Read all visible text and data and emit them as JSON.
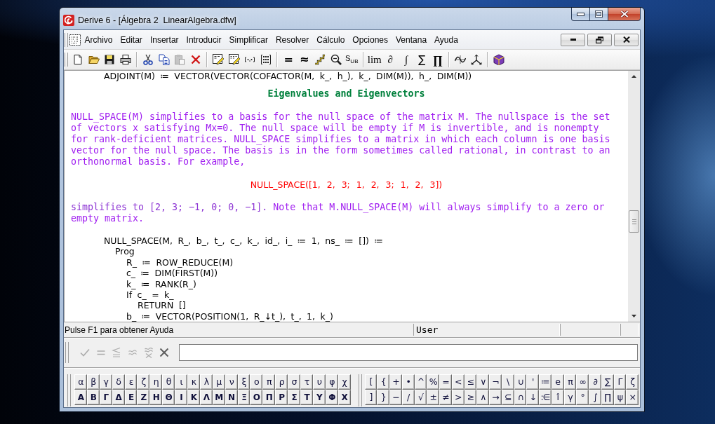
{
  "window": {
    "title": "Derive 6 - [Álgebra 2  LinearAlgebra.dfw]"
  },
  "menu_bar": {
    "items": [
      "Archivo",
      "Editar",
      "Insertar",
      "Introducir",
      "Simplificar",
      "Resolver",
      "Cálculo",
      "Opciones",
      "Ventana",
      "Ayuda"
    ]
  },
  "toolbar": {
    "groups": [
      [
        {
          "kind": "new",
          "disabled": false
        },
        {
          "kind": "open",
          "disabled": false
        },
        {
          "kind": "save",
          "disabled": false
        },
        {
          "kind": "print",
          "disabled": false
        }
      ],
      [
        {
          "kind": "cut",
          "disabled": false
        },
        {
          "kind": "copy",
          "disabled": false
        },
        {
          "kind": "paste",
          "disabled": true
        },
        {
          "kind": "delete",
          "disabled": false
        }
      ],
      [
        {
          "kind": "author",
          "disabled": false
        },
        {
          "kind": "table",
          "disabled": false
        },
        {
          "kind": "vector",
          "disabled": false
        },
        {
          "kind": "matrix",
          "disabled": false
        }
      ],
      [
        {
          "kind": "equals",
          "label": "=",
          "disabled": false
        },
        {
          "kind": "approximate",
          "label": "≈",
          "disabled": false
        },
        {
          "kind": "step",
          "disabled": false
        },
        {
          "kind": "zoom",
          "disabled": false
        },
        {
          "kind": "substitute",
          "label": "S$_{UB}$",
          "disabled": false
        }
      ],
      [
        {
          "kind": "limit",
          "label": "lim",
          "disabled": false
        },
        {
          "kind": "derivative",
          "label": "∂",
          "disabled": false
        },
        {
          "kind": "integral",
          "label": "∫",
          "disabled": false
        },
        {
          "kind": "sum",
          "label": "∑",
          "disabled": false
        },
        {
          "kind": "product",
          "label": "∏",
          "disabled": false
        }
      ],
      [
        {
          "kind": "plot",
          "disabled": false
        },
        {
          "kind": "axes",
          "disabled": false
        }
      ],
      [
        {
          "kind": "book",
          "disabled": false
        }
      ]
    ]
  },
  "document": {
    "blocks": [
      {
        "kind": "expression",
        "lines": [
          {
            "text": "ADJOINT(M) ≔ VECTOR(VECTOR(COFACTOR(M, k_, h_), k_, DIM(M)), h_, DIM(M))"
          }
        ]
      },
      {
        "kind": "heading",
        "text": "Eigenvalues and Eigenvectors"
      },
      {
        "kind": "paragraph",
        "segments": [
          {
            "kind": "prose",
            "text": "NULL_SPACE(M) simplifies to a basis for the null space of the matrix M. The nullspace is the set of vectors x satisfying Mx=0. The null space will be empty if M is invertible, and is nonempty for rank-deficient matrices. NULL_SPACE simplifies to a matrix in which each column is one basis vector for the null space. The basis is in the form sometimes called rational, in contrast to an orthonormal basis. For example,"
          }
        ]
      },
      {
        "kind": "example",
        "text": "NULL_SPACE([1, 2, 3; 1, 2, 3; 1, 2, 3])"
      },
      {
        "kind": "paragraph",
        "segments": [
          {
            "kind": "math",
            "text": "simplifies to [2, 3; −1, 0; 0, −1]."
          },
          {
            "kind": "prose",
            "text": " Note that M.NULL_SPACE(M) will always simplify to a zero or empty matrix."
          }
        ]
      },
      {
        "kind": "expression",
        "lines": [
          {
            "text": "NULL_SPACE(M, R_, b_, t_, c_, k_, id_, i_ ≔ 1, ns_ ≔ []) ≔",
            "children": [
              {
                "text": "Prog",
                "children": [
                  {
                    "text": "R_ ≔ ROW_REDUCE(M)"
                  },
                  {
                    "text": "c_ ≔ DIM(FIRST(M))"
                  },
                  {
                    "text": "k_ ≔ RANK(R_)"
                  },
                  {
                    "text": "If c_ = k_",
                    "children": [
                      {
                        "text": "RETURN []"
                      }
                    ]
                  },
                  {
                    "text": "b_ ≔ VECTOR(POSITION(1, R_↓t_), t_, 1, k_)"
                  }
                ]
              }
            ]
          }
        ]
      }
    ]
  },
  "status_bar": {
    "message": "Pulse F1 para obtener Ayuda",
    "panels": [
      "User"
    ]
  },
  "entry_bar": {
    "buttons": [
      {
        "kind": "check",
        "disabled": true
      },
      {
        "kind": "equals",
        "disabled": true
      },
      {
        "kind": "lessequal",
        "disabled": true
      },
      {
        "kind": "approx",
        "disabled": true
      },
      {
        "kind": "approxstack",
        "disabled": true
      },
      {
        "kind": "cancel",
        "disabled": false
      }
    ]
  },
  "palettes": [
    {
      "rows": [
        [
          "α",
          "β",
          "γ",
          "δ",
          "ε",
          "ζ",
          "η",
          "θ",
          "ι",
          "κ",
          "λ",
          "μ",
          "ν",
          "ξ",
          "ο",
          "π",
          "ρ",
          "σ",
          "τ",
          "υ",
          "φ",
          "χ"
        ],
        [
          "Α",
          "Β",
          "Γ",
          "Δ",
          "Ε",
          "Ζ",
          "Η",
          "Θ",
          "Ι",
          "Κ",
          "Λ",
          "Μ",
          "Ν",
          "Ξ",
          "Ο",
          "Π",
          "Ρ",
          "Σ",
          "Τ",
          "Υ",
          "Φ",
          "Χ"
        ]
      ]
    },
    {
      "rows": [
        [
          "[",
          "{",
          "+",
          "•",
          "^",
          "%",
          "=",
          "<",
          "≤",
          "∨",
          "¬",
          "\\",
          "∪",
          "'",
          "≔",
          "e",
          "π",
          "∞",
          "∂",
          "∑",
          "Γ",
          "ζ"
        ],
        [
          "]",
          "}",
          "−",
          "/",
          "√",
          "±",
          "≠",
          ">",
          "≥",
          "∧",
          "→",
          "⊆",
          "∩",
          "↓",
          ":∈",
          "î",
          "γ",
          "°",
          "∫",
          "∏",
          "ψ",
          "×"
        ]
      ]
    }
  ]
}
